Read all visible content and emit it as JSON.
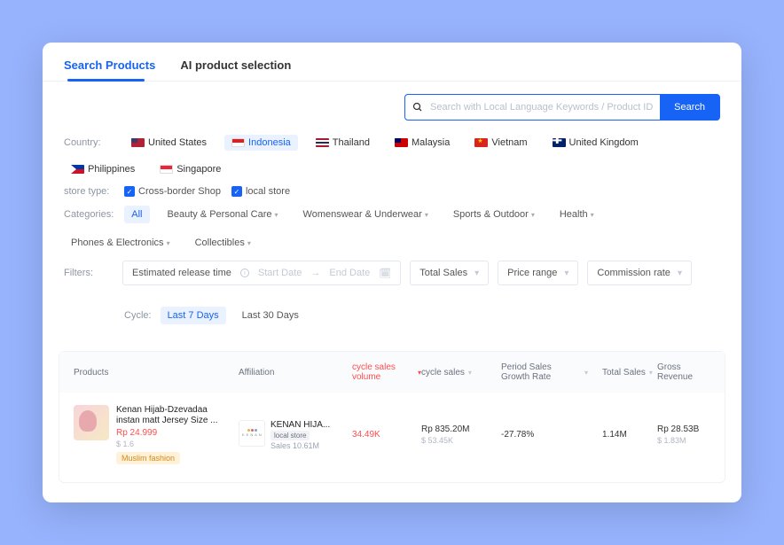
{
  "tabs": {
    "t0": "Search Products",
    "t1": "AI product selection"
  },
  "search": {
    "placeholder": "Search with Local Language Keywords / Product ID",
    "button": "Search"
  },
  "labels": {
    "country": "Country:",
    "storeType": "store type:",
    "categories": "Categories:",
    "filters": "Filters:",
    "cycle": "Cycle:"
  },
  "countries": {
    "us": "United States",
    "id": "Indonesia",
    "th": "Thailand",
    "my": "Malaysia",
    "vn": "Vietnam",
    "uk": "United Kingdom",
    "ph": "Philippines",
    "sg": "Singapore"
  },
  "storeTypes": {
    "cross": "Cross-border Shop",
    "local": "local store"
  },
  "categories": {
    "all": "All",
    "beauty": "Beauty & Personal Care",
    "womens": "Womenswear & Underwear",
    "sports": "Sports & Outdoor",
    "health": "Health",
    "phones": "Phones & Electronics",
    "collect": "Collectibles"
  },
  "filterRow": {
    "release": "Estimated release time",
    "startDate": "Start Date",
    "endDate": "End Date",
    "totalSales": "Total Sales",
    "priceRange": "Price range",
    "commission": "Commission rate"
  },
  "cycle": {
    "d7": "Last 7 Days",
    "d30": "Last 30 Days"
  },
  "th": {
    "products": "Products",
    "affiliation": "Affiliation",
    "csv": "cycle sales volume",
    "cs": "cycle sales",
    "gr": "Period Sales Growth Rate",
    "ts": "Total Sales",
    "rev": "Gross Revenue"
  },
  "row0": {
    "title": "Kenan Hijab-Dzevadaa instan matt Jersey Size ...",
    "price": "Rp 24.999",
    "priceUsd": "$ 1.6",
    "tag": "Muslim fashion",
    "affName": "KENAN HIJA...",
    "affLogo": "K E N A N",
    "affType": "local store",
    "affSales": "Sales 10.61M",
    "csv": "34.49K",
    "cs": "Rp 835.20M",
    "csUsd": "$ 53.45K",
    "gr": "-27.78%",
    "ts": "1.14M",
    "rev": "Rp 28.53B",
    "revUsd": "$ 1.83M"
  }
}
